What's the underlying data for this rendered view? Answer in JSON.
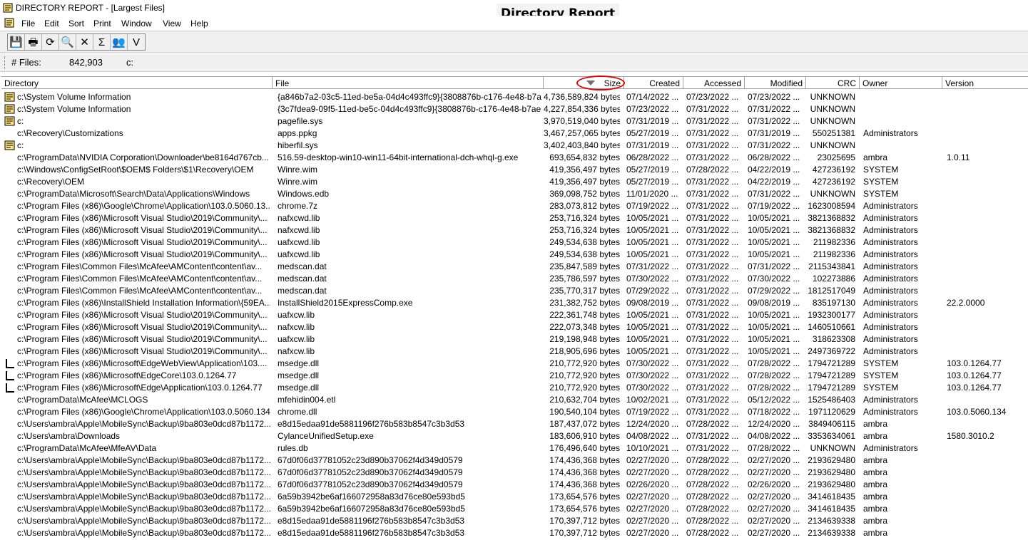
{
  "window": {
    "title": "DIRECTORY REPORT - [Largest Files]"
  },
  "overlay_title": "Directory Report",
  "menu": [
    "File",
    "Edit",
    "Sort",
    "Print",
    "Window",
    "View",
    "Help"
  ],
  "toolbar": [
    {
      "icon": "save-icon",
      "glyph": "💾"
    },
    {
      "icon": "printer-icon",
      "glyph": "🖶"
    },
    {
      "icon": "refresh-icon",
      "glyph": "⟳"
    },
    {
      "icon": "find-icon",
      "glyph": "🔍"
    },
    {
      "icon": "close-icon",
      "glyph": "✕"
    },
    {
      "icon": "sum-icon",
      "glyph": "Σ"
    },
    {
      "icon": "owners-icon",
      "glyph": "👥"
    },
    {
      "icon": "filter-icon",
      "glyph": "V"
    }
  ],
  "status": {
    "label": "# Files:",
    "count": "842,903",
    "drive": "c:"
  },
  "columns": [
    "Directory",
    "File",
    "Size",
    "Created",
    "Accessed",
    "Modified",
    "CRC",
    "Owner",
    "Version"
  ],
  "sort": {
    "column": "Size",
    "direction": "descending"
  },
  "rows": [
    {
      "icon": "folder",
      "dir": "c:\\System Volume Information",
      "file": "{a846b7a2-03c5-11ed-be5a-04d4c493ffc9}{3808876b-c176-4e48-b7a...",
      "size": "4,736,589,824 bytes",
      "created": "07/14/2022 ...",
      "accessed": "07/23/2022 ...",
      "modified": "07/23/2022 ...",
      "crc": "UNKNOWN",
      "owner": "",
      "version": ""
    },
    {
      "icon": "folder",
      "dir": "c:\\System Volume Information",
      "file": "{3c7fdea9-09f5-11ed-be5c-04d4c493ffc9}{3808876b-c176-4e48-b7ae...",
      "size": "4,227,854,336 bytes",
      "created": "07/23/2022 ...",
      "accessed": "07/31/2022 ...",
      "modified": "07/31/2022 ...",
      "crc": "UNKNOWN",
      "owner": "",
      "version": ""
    },
    {
      "icon": "folder",
      "dir": "c:",
      "file": "pagefile.sys",
      "size": "3,970,519,040 bytes",
      "created": "07/31/2019 ...",
      "accessed": "07/31/2022 ...",
      "modified": "07/31/2022 ...",
      "crc": "UNKNOWN",
      "owner": "",
      "version": ""
    },
    {
      "icon": "",
      "dir": "c:\\Recovery\\Customizations",
      "file": "apps.ppkg",
      "size": "3,467,257,065 bytes",
      "created": "05/27/2019 ...",
      "accessed": "07/31/2022 ...",
      "modified": "07/31/2019 ...",
      "crc": "550251381",
      "owner": "Administrators",
      "version": ""
    },
    {
      "icon": "folder",
      "dir": "c:",
      "file": "hiberfil.sys",
      "size": "3,402,403,840 bytes",
      "created": "07/31/2019 ...",
      "accessed": "07/31/2022 ...",
      "modified": "07/31/2022 ...",
      "crc": "UNKNOWN",
      "owner": "",
      "version": ""
    },
    {
      "icon": "",
      "dir": "c:\\ProgramData\\NVIDIA Corporation\\Downloader\\be8164d767cb...",
      "file": "516.59-desktop-win10-win11-64bit-international-dch-whql-g.exe",
      "size": "693,654,832 bytes",
      "created": "06/28/2022 ...",
      "accessed": "07/31/2022 ...",
      "modified": "06/28/2022 ...",
      "crc": "23025695",
      "owner": "ambra",
      "version": "1.0.11"
    },
    {
      "icon": "",
      "dir": "c:\\Windows\\ConfigSetRoot\\$OEM$ Folders\\$1\\Recovery\\OEM",
      "file": "Winre.wim",
      "size": "419,356,497 bytes",
      "created": "05/27/2019 ...",
      "accessed": "07/28/2022 ...",
      "modified": "04/22/2019 ...",
      "crc": "427236192",
      "owner": "SYSTEM",
      "version": ""
    },
    {
      "icon": "",
      "dir": "c:\\Recovery\\OEM",
      "file": "Winre.wim",
      "size": "419,356,497 bytes",
      "created": "05/27/2019 ...",
      "accessed": "07/31/2022 ...",
      "modified": "04/22/2019 ...",
      "crc": "427236192",
      "owner": "SYSTEM",
      "version": ""
    },
    {
      "icon": "",
      "dir": "c:\\ProgramData\\Microsoft\\Search\\Data\\Applications\\Windows",
      "file": "Windows.edb",
      "size": "369,098,752 bytes",
      "created": "11/01/2020 ...",
      "accessed": "07/31/2022 ...",
      "modified": "07/31/2022 ...",
      "crc": "UNKNOWN",
      "owner": "SYSTEM",
      "version": ""
    },
    {
      "icon": "",
      "dir": "c:\\Program Files (x86)\\Google\\Chrome\\Application\\103.0.5060.13...",
      "file": "chrome.7z",
      "size": "283,073,812 bytes",
      "created": "07/19/2022 ...",
      "accessed": "07/31/2022 ...",
      "modified": "07/19/2022 ...",
      "crc": "1623008594",
      "owner": "Administrators",
      "version": ""
    },
    {
      "icon": "",
      "dir": "c:\\Program Files (x86)\\Microsoft Visual Studio\\2019\\Community\\...",
      "file": "nafxcwd.lib",
      "size": "253,716,324 bytes",
      "created": "10/05/2021 ...",
      "accessed": "07/31/2022 ...",
      "modified": "10/05/2021 ...",
      "crc": "3821368832",
      "owner": "Administrators",
      "version": ""
    },
    {
      "icon": "",
      "dir": "c:\\Program Files (x86)\\Microsoft Visual Studio\\2019\\Community\\...",
      "file": "nafxcwd.lib",
      "size": "253,716,324 bytes",
      "created": "10/05/2021 ...",
      "accessed": "07/31/2022 ...",
      "modified": "10/05/2021 ...",
      "crc": "3821368832",
      "owner": "Administrators",
      "version": ""
    },
    {
      "icon": "",
      "dir": "c:\\Program Files (x86)\\Microsoft Visual Studio\\2019\\Community\\...",
      "file": "uafxcwd.lib",
      "size": "249,534,638 bytes",
      "created": "10/05/2021 ...",
      "accessed": "07/31/2022 ...",
      "modified": "10/05/2021 ...",
      "crc": "211982336",
      "owner": "Administrators",
      "version": ""
    },
    {
      "icon": "",
      "dir": "c:\\Program Files (x86)\\Microsoft Visual Studio\\2019\\Community\\...",
      "file": "uafxcwd.lib",
      "size": "249,534,638 bytes",
      "created": "10/05/2021 ...",
      "accessed": "07/31/2022 ...",
      "modified": "10/05/2021 ...",
      "crc": "211982336",
      "owner": "Administrators",
      "version": ""
    },
    {
      "icon": "",
      "dir": "c:\\Program Files\\Common Files\\McAfee\\AMContent\\content\\av...",
      "file": "medscan.dat",
      "size": "235,847,589 bytes",
      "created": "07/31/2022 ...",
      "accessed": "07/31/2022 ...",
      "modified": "07/31/2022 ...",
      "crc": "2115343841",
      "owner": "Administrators",
      "version": ""
    },
    {
      "icon": "",
      "dir": "c:\\Program Files\\Common Files\\McAfee\\AMContent\\content\\av...",
      "file": "medscan.dat",
      "size": "235,786,597 bytes",
      "created": "07/30/2022 ...",
      "accessed": "07/31/2022 ...",
      "modified": "07/30/2022 ...",
      "crc": "102273886",
      "owner": "Administrators",
      "version": ""
    },
    {
      "icon": "",
      "dir": "c:\\Program Files\\Common Files\\McAfee\\AMContent\\content\\av...",
      "file": "medscan.dat",
      "size": "235,770,317 bytes",
      "created": "07/29/2022 ...",
      "accessed": "07/31/2022 ...",
      "modified": "07/29/2022 ...",
      "crc": "1812517049",
      "owner": "Administrators",
      "version": ""
    },
    {
      "icon": "",
      "dir": "c:\\Program Files (x86)\\InstallShield Installation Information\\{59EA...",
      "file": "InstallShield2015ExpressComp.exe",
      "size": "231,382,752 bytes",
      "created": "09/08/2019 ...",
      "accessed": "07/31/2022 ...",
      "modified": "09/08/2019 ...",
      "crc": "835197130",
      "owner": "Administrators",
      "version": "22.2.0000"
    },
    {
      "icon": "",
      "dir": "c:\\Program Files (x86)\\Microsoft Visual Studio\\2019\\Community\\...",
      "file": "uafxcw.lib",
      "size": "222,361,748 bytes",
      "created": "10/05/2021 ...",
      "accessed": "07/31/2022 ...",
      "modified": "10/05/2021 ...",
      "crc": "1932300177",
      "owner": "Administrators",
      "version": ""
    },
    {
      "icon": "",
      "dir": "c:\\Program Files (x86)\\Microsoft Visual Studio\\2019\\Community\\...",
      "file": "nafxcw.lib",
      "size": "222,073,348 bytes",
      "created": "10/05/2021 ...",
      "accessed": "07/31/2022 ...",
      "modified": "10/05/2021 ...",
      "crc": "1460510661",
      "owner": "Administrators",
      "version": ""
    },
    {
      "icon": "",
      "dir": "c:\\Program Files (x86)\\Microsoft Visual Studio\\2019\\Community\\...",
      "file": "uafxcw.lib",
      "size": "219,198,948 bytes",
      "created": "10/05/2021 ...",
      "accessed": "07/31/2022 ...",
      "modified": "10/05/2021 ...",
      "crc": "318623308",
      "owner": "Administrators",
      "version": ""
    },
    {
      "icon": "",
      "dir": "c:\\Program Files (x86)\\Microsoft Visual Studio\\2019\\Community\\...",
      "file": "nafxcw.lib",
      "size": "218,905,696 bytes",
      "created": "10/05/2021 ...",
      "accessed": "07/31/2022 ...",
      "modified": "10/05/2021 ...",
      "crc": "2497369722",
      "owner": "Administrators",
      "version": ""
    },
    {
      "icon": "link",
      "dir": "c:\\Program Files (x86)\\Microsoft\\EdgeWebView\\Application\\103....",
      "file": "msedge.dll",
      "size": "210,772,920 bytes",
      "created": "07/30/2022 ...",
      "accessed": "07/31/2022 ...",
      "modified": "07/28/2022 ...",
      "crc": "1794721289",
      "owner": "SYSTEM",
      "version": "103.0.1264.77"
    },
    {
      "icon": "link",
      "dir": "c:\\Program Files (x86)\\Microsoft\\EdgeCore\\103.0.1264.77",
      "file": "msedge.dll",
      "size": "210,772,920 bytes",
      "created": "07/30/2022 ...",
      "accessed": "07/31/2022 ...",
      "modified": "07/28/2022 ...",
      "crc": "1794721289",
      "owner": "SYSTEM",
      "version": "103.0.1264.77"
    },
    {
      "icon": "link",
      "dir": "c:\\Program Files (x86)\\Microsoft\\Edge\\Application\\103.0.1264.77",
      "file": "msedge.dll",
      "size": "210,772,920 bytes",
      "created": "07/30/2022 ...",
      "accessed": "07/31/2022 ...",
      "modified": "07/28/2022 ...",
      "crc": "1794721289",
      "owner": "SYSTEM",
      "version": "103.0.1264.77"
    },
    {
      "icon": "",
      "dir": "c:\\ProgramData\\McAfee\\MCLOGS",
      "file": "mfehidin004.etl",
      "size": "210,632,704 bytes",
      "created": "10/02/2021 ...",
      "accessed": "07/31/2022 ...",
      "modified": "05/12/2022 ...",
      "crc": "1525486403",
      "owner": "Administrators",
      "version": ""
    },
    {
      "icon": "",
      "dir": "c:\\Program Files (x86)\\Google\\Chrome\\Application\\103.0.5060.134",
      "file": "chrome.dll",
      "size": "190,540,104 bytes",
      "created": "07/19/2022 ...",
      "accessed": "07/31/2022 ...",
      "modified": "07/18/2022 ...",
      "crc": "1971120629",
      "owner": "Administrators",
      "version": "103.0.5060.134"
    },
    {
      "icon": "",
      "dir": "c:\\Users\\ambra\\Apple\\MobileSync\\Backup\\9ba803e0dcd87b1172...",
      "file": "e8d15edaa91de5881196f276b583b8547c3b3d53",
      "size": "187,437,072 bytes",
      "created": "12/24/2020 ...",
      "accessed": "07/28/2022 ...",
      "modified": "12/24/2020 ...",
      "crc": "3849406115",
      "owner": "ambra",
      "version": ""
    },
    {
      "icon": "",
      "dir": "c:\\Users\\ambra\\Downloads",
      "file": "CylanceUnifiedSetup.exe",
      "size": "183,606,910 bytes",
      "created": "04/08/2022 ...",
      "accessed": "07/31/2022 ...",
      "modified": "04/08/2022 ...",
      "crc": "3353634061",
      "owner": "ambra",
      "version": "1580.3010.2"
    },
    {
      "icon": "",
      "dir": "c:\\ProgramData\\McAfee\\MfeAV\\Data",
      "file": "rules.db",
      "size": "176,496,640 bytes",
      "created": "10/10/2021 ...",
      "accessed": "07/31/2022 ...",
      "modified": "07/28/2022 ...",
      "crc": "UNKNOWN",
      "owner": "Administrators",
      "version": ""
    },
    {
      "icon": "",
      "dir": "c:\\Users\\ambra\\Apple\\MobileSync\\Backup\\9ba803e0dcd87b1172...",
      "file": "67d0f06d37781052c23d890b37062f4d349d0579",
      "size": "174,436,368 bytes",
      "created": "02/27/2020 ...",
      "accessed": "07/28/2022 ...",
      "modified": "02/27/2020 ...",
      "crc": "2193629480",
      "owner": "ambra",
      "version": ""
    },
    {
      "icon": "",
      "dir": "c:\\Users\\ambra\\Apple\\MobileSync\\Backup\\9ba803e0dcd87b1172...",
      "file": "67d0f06d37781052c23d890b37062f4d349d0579",
      "size": "174,436,368 bytes",
      "created": "02/27/2020 ...",
      "accessed": "07/28/2022 ...",
      "modified": "02/27/2020 ...",
      "crc": "2193629480",
      "owner": "ambra",
      "version": ""
    },
    {
      "icon": "",
      "dir": "c:\\Users\\ambra\\Apple\\MobileSync\\Backup\\9ba803e0dcd87b1172...",
      "file": "67d0f06d37781052c23d890b37062f4d349d0579",
      "size": "174,436,368 bytes",
      "created": "02/26/2020 ...",
      "accessed": "07/28/2022 ...",
      "modified": "02/26/2020 ...",
      "crc": "2193629480",
      "owner": "ambra",
      "version": ""
    },
    {
      "icon": "",
      "dir": "c:\\Users\\ambra\\Apple\\MobileSync\\Backup\\9ba803e0dcd87b1172...",
      "file": "6a59b3942be6af166072958a83d76ce80e593bd5",
      "size": "173,654,576 bytes",
      "created": "02/27/2020 ...",
      "accessed": "07/28/2022 ...",
      "modified": "02/27/2020 ...",
      "crc": "3414618435",
      "owner": "ambra",
      "version": ""
    },
    {
      "icon": "",
      "dir": "c:\\Users\\ambra\\Apple\\MobileSync\\Backup\\9ba803e0dcd87b1172...",
      "file": "6a59b3942be6af166072958a83d76ce80e593bd5",
      "size": "173,654,576 bytes",
      "created": "02/27/2020 ...",
      "accessed": "07/28/2022 ...",
      "modified": "02/27/2020 ...",
      "crc": "3414618435",
      "owner": "ambra",
      "version": ""
    },
    {
      "icon": "",
      "dir": "c:\\Users\\ambra\\Apple\\MobileSync\\Backup\\9ba803e0dcd87b1172...",
      "file": "e8d15edaa91de5881196f276b583b8547c3b3d53",
      "size": "170,397,712 bytes",
      "created": "02/27/2020 ...",
      "accessed": "07/28/2022 ...",
      "modified": "02/27/2020 ...",
      "crc": "2134639338",
      "owner": "ambra",
      "version": ""
    },
    {
      "icon": "",
      "dir": "c:\\Users\\ambra\\Apple\\MobileSync\\Backup\\9ba803e0dcd87b1172...",
      "file": "e8d15edaa91de5881196f276b583b8547c3b3d53",
      "size": "170,397,712 bytes",
      "created": "02/27/2020 ...",
      "accessed": "07/28/2022 ...",
      "modified": "02/27/2020 ...",
      "crc": "2134639338",
      "owner": "ambra",
      "version": ""
    }
  ]
}
